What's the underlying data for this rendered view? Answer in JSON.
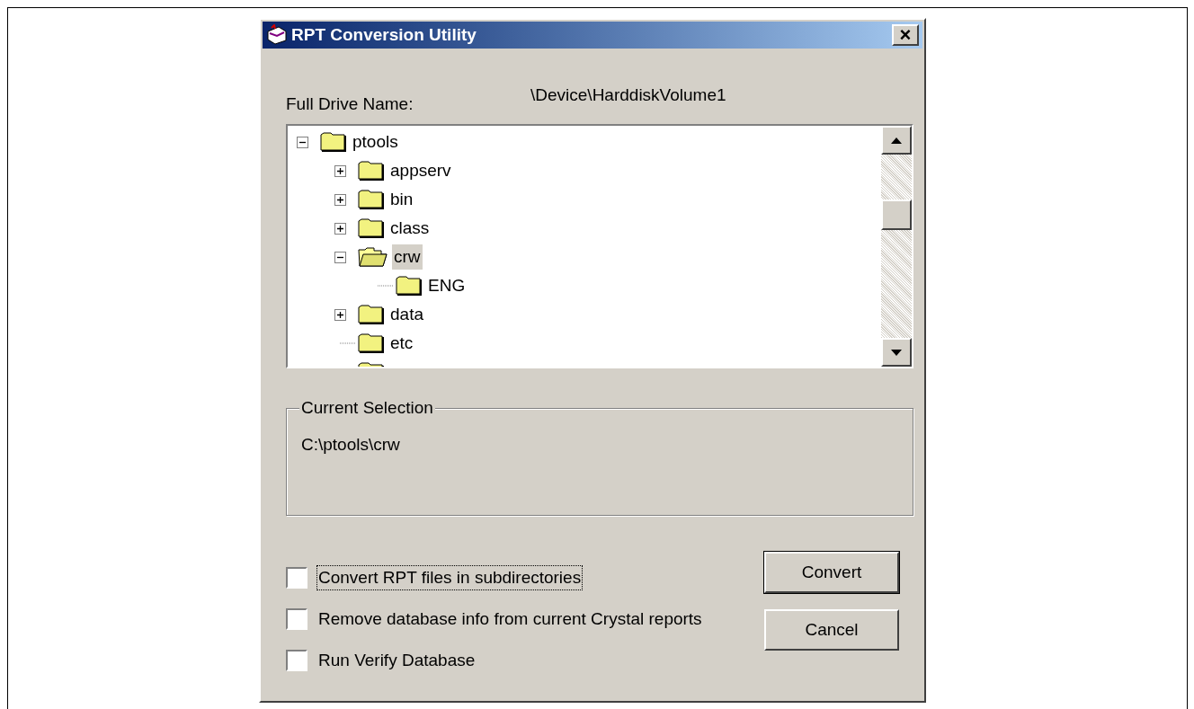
{
  "window": {
    "title": "RPT Conversion Utility",
    "close": "×"
  },
  "drive": {
    "label": "Full Drive Name:",
    "value": "\\Device\\HarddiskVolume1"
  },
  "tree": {
    "items": [
      {
        "label": "ptools",
        "kind": "expanded",
        "selected": false,
        "children": [
          {
            "label": "appserv",
            "kind": "collapsed",
            "selected": false
          },
          {
            "label": "bin",
            "kind": "collapsed",
            "selected": false
          },
          {
            "label": "class",
            "kind": "collapsed",
            "selected": false
          },
          {
            "label": "crw",
            "kind": "expanded",
            "selected": true,
            "children": [
              {
                "label": "ENG",
                "kind": "leaf",
                "selected": false
              }
            ]
          },
          {
            "label": "data",
            "kind": "collapsed",
            "selected": false
          },
          {
            "label": "etc",
            "kind": "leaf",
            "selected": false
          }
        ]
      }
    ]
  },
  "current_selection": {
    "title": "Current Selection",
    "value": "C:\\ptools\\crw"
  },
  "options": [
    {
      "label": "Convert RPT files in subdirectories",
      "checked": false,
      "focused": true
    },
    {
      "label": "Remove database info from current Crystal reports",
      "checked": false,
      "focused": false
    },
    {
      "label": "Run Verify Database",
      "checked": false,
      "focused": false
    }
  ],
  "buttons": [
    {
      "label": "Convert",
      "default": true
    },
    {
      "label": "Cancel",
      "default": false
    }
  ]
}
